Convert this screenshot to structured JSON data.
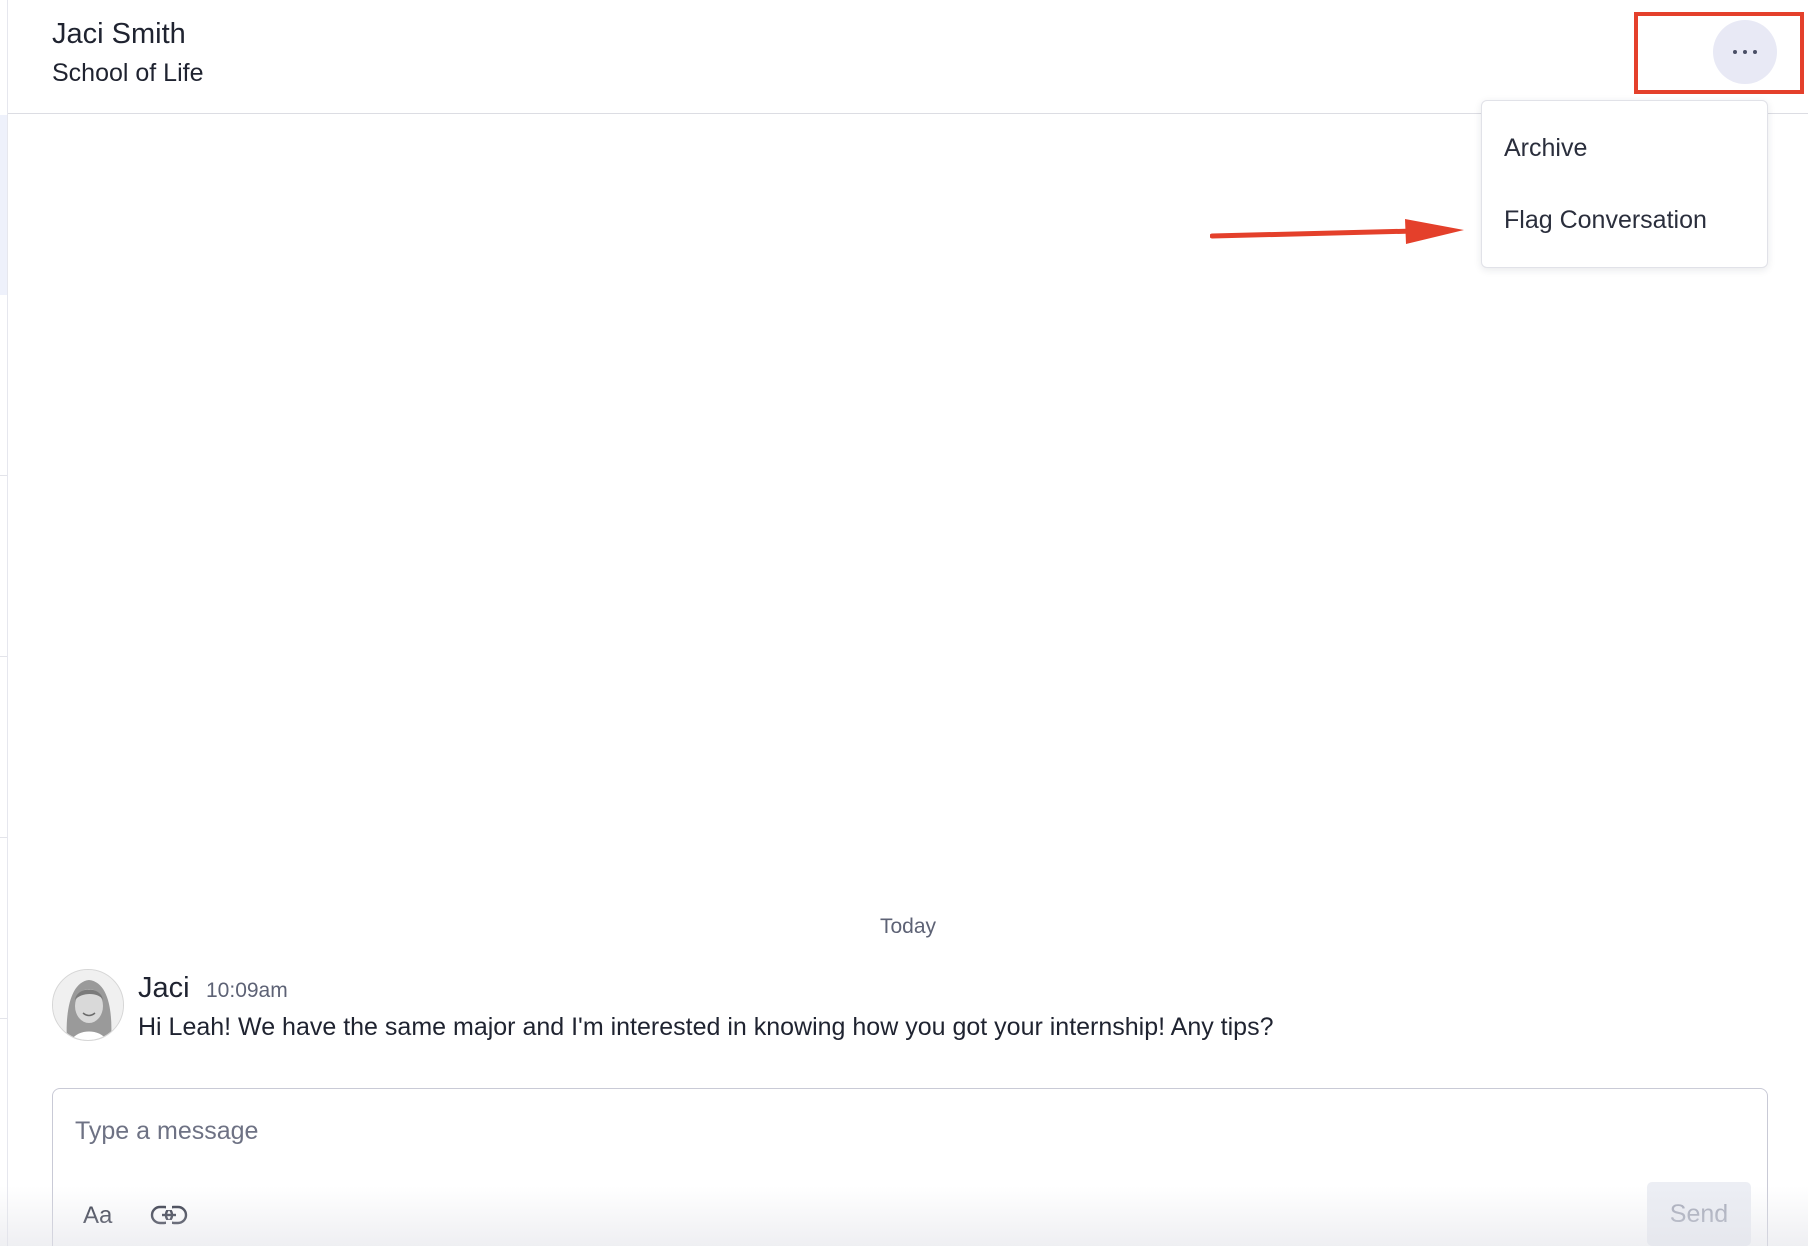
{
  "header": {
    "contact_name": "Jaci Smith",
    "contact_org": "School of Life",
    "more_icon": "more-horizontal-icon"
  },
  "menu": {
    "items": [
      {
        "label": "Archive"
      },
      {
        "label": "Flag Conversation"
      }
    ]
  },
  "thread": {
    "day_divider": "Today",
    "messages": [
      {
        "sender": "Jaci",
        "time": "10:09am",
        "text": "Hi Leah! We have the same major and I'm interested in knowing how you got your internship! Any tips?"
      }
    ]
  },
  "composer": {
    "placeholder": "Type a message",
    "format_label": "Aa",
    "link_icon": "link-icon",
    "send_label": "Send"
  },
  "colors": {
    "annotation": "#e4402b",
    "more_button_bg": "#e8e9f5",
    "send_disabled_text": "#a5a9b8"
  }
}
